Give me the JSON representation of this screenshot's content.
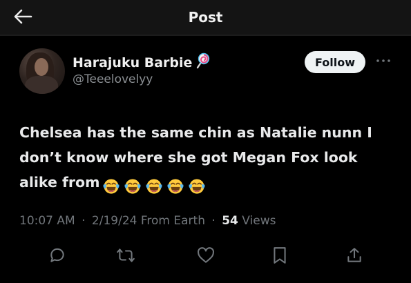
{
  "header": {
    "title": "Post",
    "back_icon": "arrow-left-icon",
    "background": "#141414"
  },
  "author": {
    "display_name": "Harajuku Barbie",
    "name_emoji": "lollipop-icon",
    "handle": "@Teeelovelyy"
  },
  "follow": {
    "label": "Follow"
  },
  "more_icon": "more-horizontal-icon",
  "post": {
    "text_line1": "Chelsea has the same chin as Natalie nunn I",
    "text_line2": "don’t know where she got Megan Fox look",
    "text_line3": "alike from",
    "emojis": [
      "face-with-tears-of-joy",
      "face-with-tears-of-joy",
      "face-with-tears-of-joy",
      "face-with-tears-of-joy",
      "face-with-tears-of-joy"
    ]
  },
  "meta": {
    "time": "10:07 AM",
    "date": "2/19/24",
    "source": "From Earth",
    "views_count": "54",
    "views_label": "Views",
    "separator": "·"
  },
  "actions": [
    "reply-icon",
    "repost-icon",
    "like-icon",
    "bookmark-icon",
    "share-icon"
  ],
  "colors": {
    "background": "#000000",
    "text_primary": "#e7e9ea",
    "text_secondary": "#71767b",
    "follow_bg": "#eff3f4"
  }
}
